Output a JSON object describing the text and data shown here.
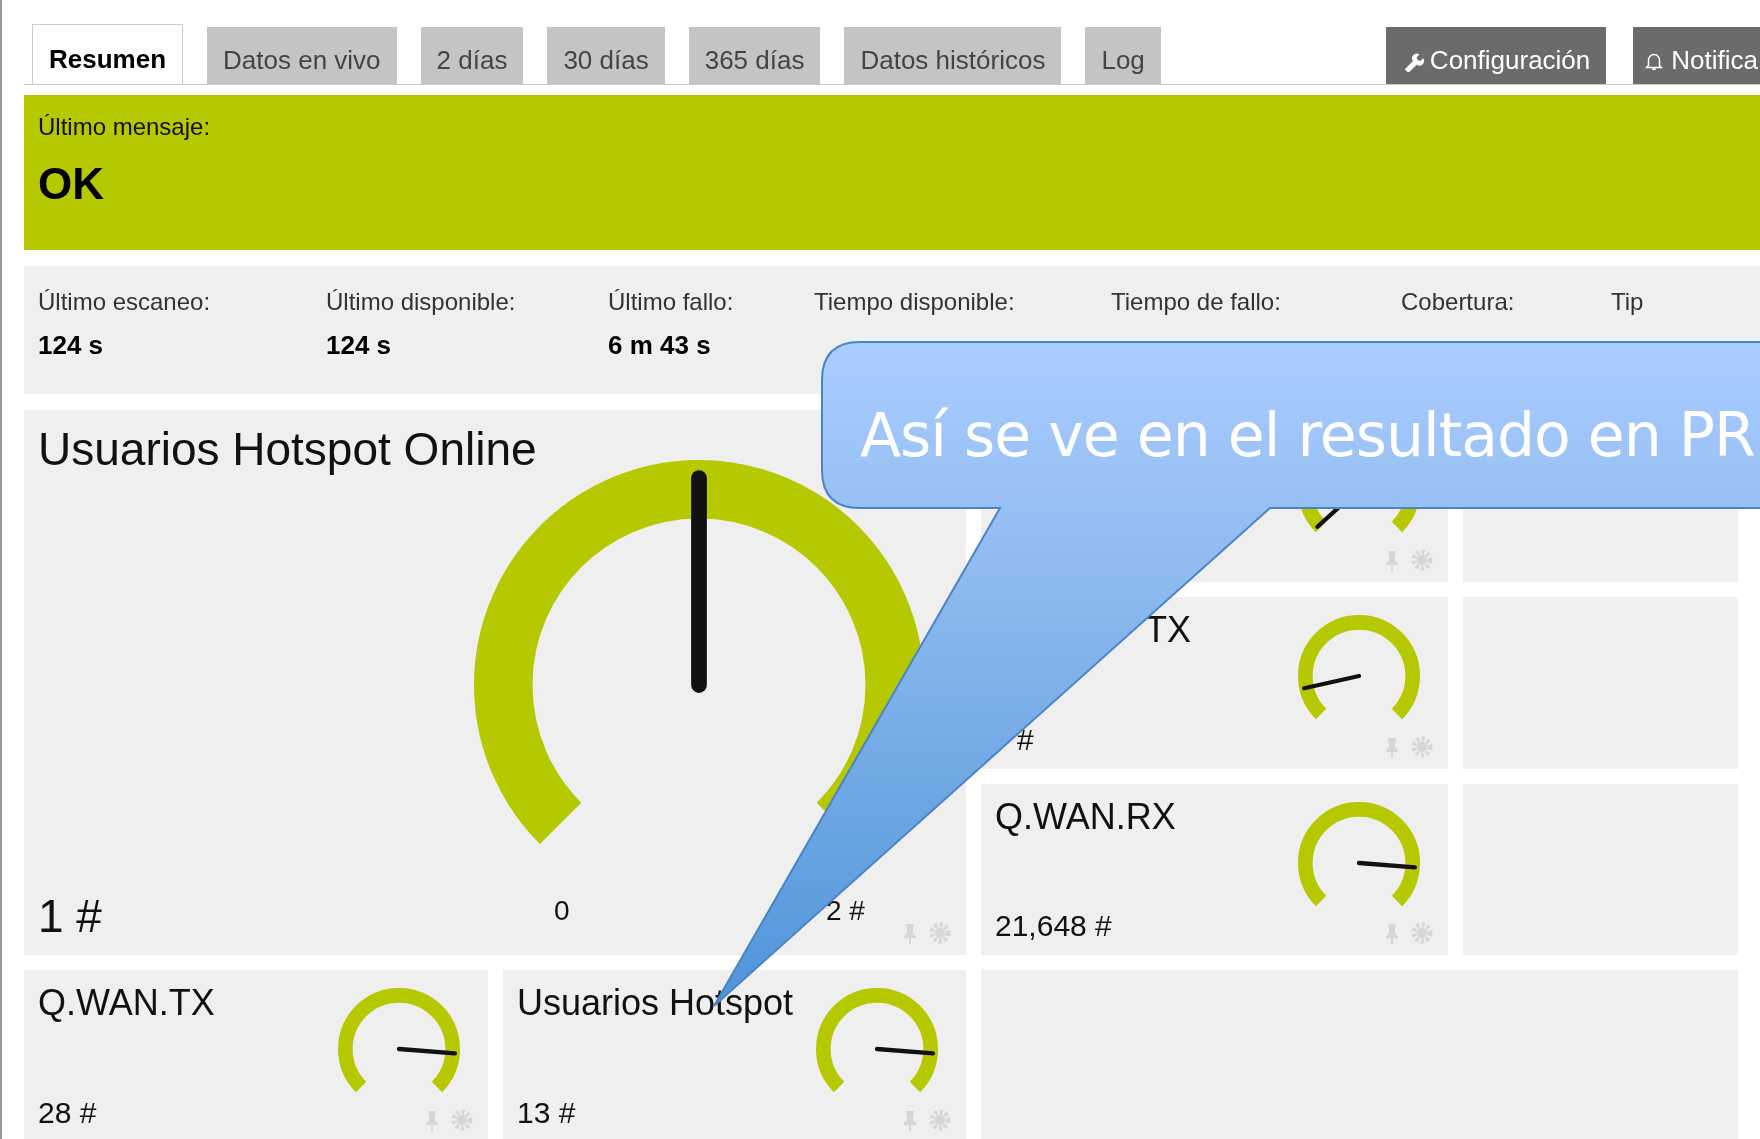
{
  "tabs": [
    {
      "label": "Resumen",
      "selected": true,
      "kind": "plain"
    },
    {
      "label": "Datos en vivo",
      "selected": false,
      "kind": "plain"
    },
    {
      "label": "2 días",
      "selected": false,
      "kind": "plain"
    },
    {
      "label": "30 días",
      "selected": false,
      "kind": "plain"
    },
    {
      "label": "365 días",
      "selected": false,
      "kind": "plain"
    },
    {
      "label": "Datos históricos",
      "selected": false,
      "kind": "plain"
    },
    {
      "label": "Log",
      "selected": false,
      "kind": "plain"
    },
    {
      "label": "Configuración",
      "selected": false,
      "kind": "settings"
    },
    {
      "label": "Notifica",
      "selected": false,
      "kind": "notifications"
    }
  ],
  "status": {
    "label": "Último mensaje:",
    "message": "OK"
  },
  "stats": [
    {
      "label": "Último escaneo:",
      "value": "124 s"
    },
    {
      "label": "Último disponible:",
      "value": "124 s"
    },
    {
      "label": "Último fallo:",
      "value": "6 m 43 s"
    },
    {
      "label": "Tiempo disponible:"
    },
    {
      "label": "Tiempo de fallo:"
    },
    {
      "label": "Cobertura:"
    },
    {
      "label": "Tip"
    }
  ],
  "main_gauge": {
    "title": "Usuarios Hotspot Online",
    "value": "1 #",
    "min": "0",
    "max": "2 #"
  },
  "side_gauges": [
    {
      "kind": "hidden"
    },
    {
      "kind": "covered",
      "title": "TX",
      "value": "#"
    },
    {
      "kind": "full",
      "title": "Q.WAN.RX",
      "value": "21,648 #"
    }
  ],
  "bottom_gauges": [
    {
      "title": "Q.WAN.TX",
      "value": "28 #"
    },
    {
      "title": "Usuarios Hotspot",
      "value": "13 #"
    }
  ],
  "callout": {
    "text": "Así se ve en el resultado en PR"
  }
}
